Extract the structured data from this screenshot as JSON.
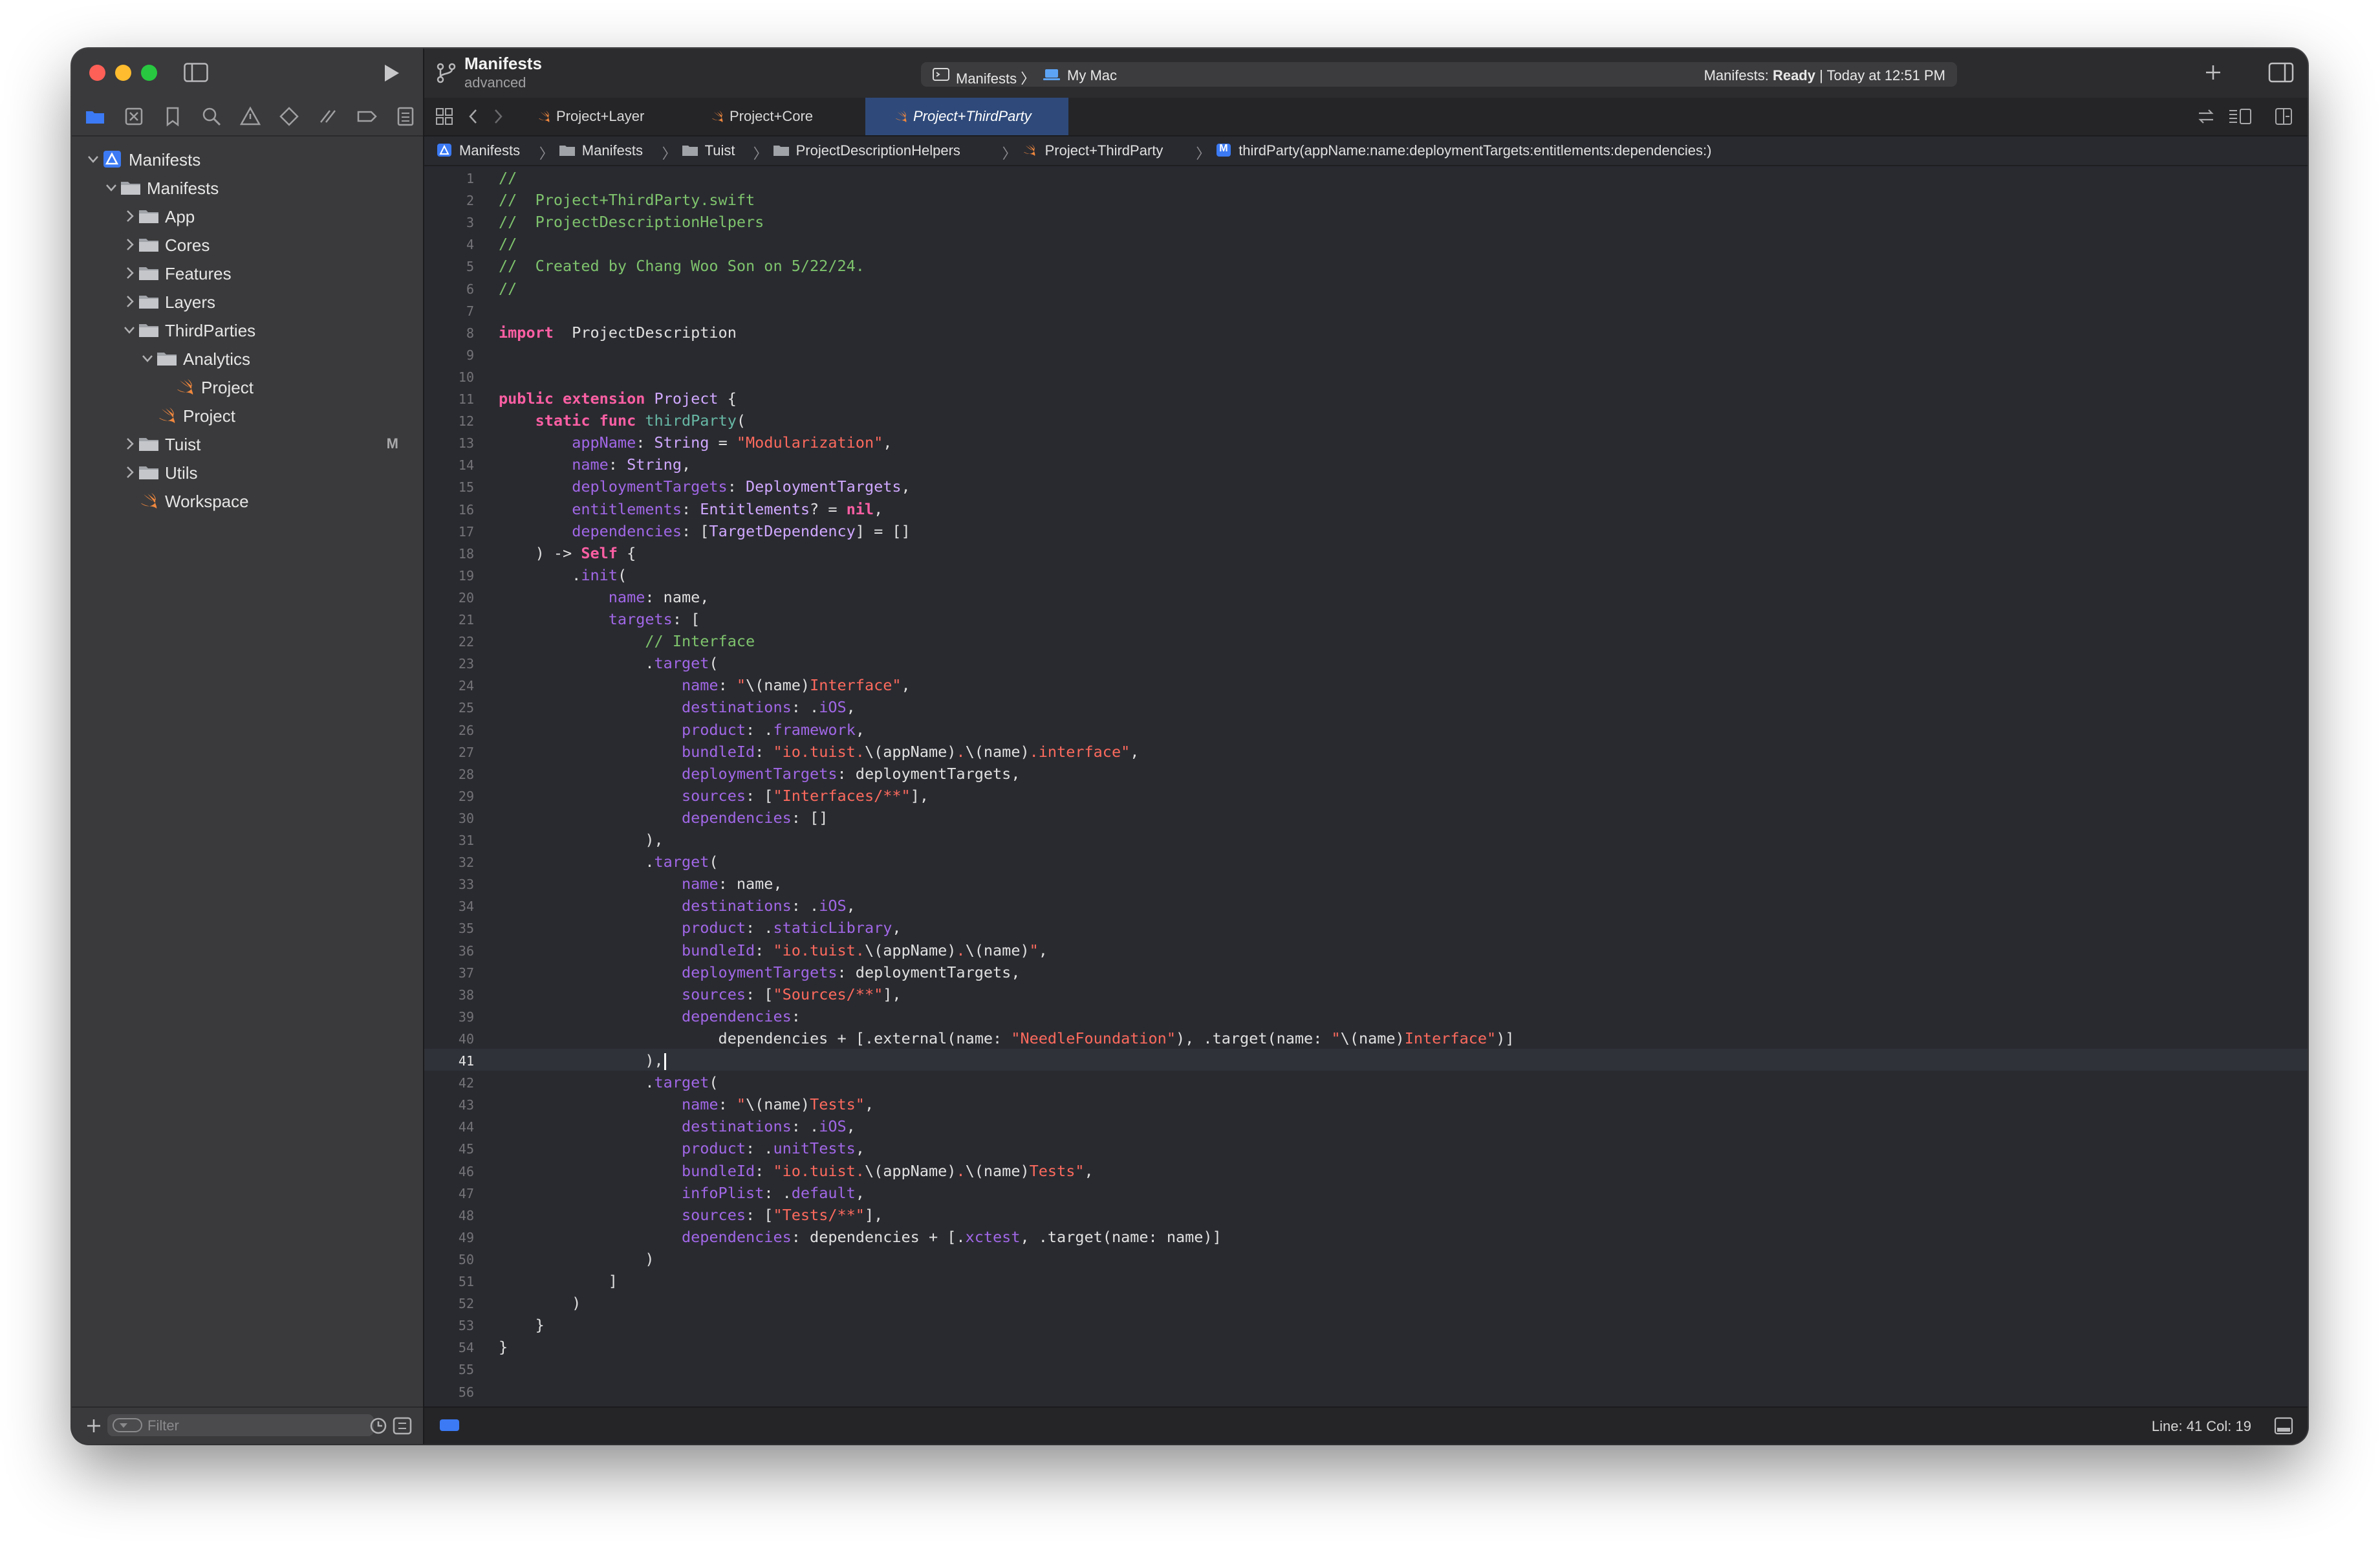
{
  "window": {
    "project_name": "Manifests",
    "project_subtitle": "advanced",
    "scheme": "Manifests",
    "destination": "My Mac",
    "status_prefix": "Manifests: ",
    "status_state": "Ready",
    "status_time": " | Today at 12:51 PM"
  },
  "navigator": {
    "items": [
      {
        "label": "Manifests",
        "icon": "xcode-project-icon",
        "indent": 0,
        "expanded": true
      },
      {
        "label": "Manifests",
        "icon": "folder-icon",
        "indent": 1,
        "expanded": true
      },
      {
        "label": "App",
        "icon": "folder-icon",
        "indent": 2,
        "expanded": false
      },
      {
        "label": "Cores",
        "icon": "folder-icon",
        "indent": 2,
        "expanded": false
      },
      {
        "label": "Features",
        "icon": "folder-icon",
        "indent": 2,
        "expanded": false
      },
      {
        "label": "Layers",
        "icon": "folder-icon",
        "indent": 2,
        "expanded": false
      },
      {
        "label": "ThirdParties",
        "icon": "folder-icon",
        "indent": 2,
        "expanded": true
      },
      {
        "label": "Analytics",
        "icon": "folder-icon",
        "indent": 3,
        "expanded": true
      },
      {
        "label": "Project",
        "icon": "swift-file-icon",
        "indent": 4,
        "expanded": null
      },
      {
        "label": "Project",
        "icon": "swift-file-icon",
        "indent": 3,
        "expanded": null
      },
      {
        "label": "Tuist",
        "icon": "folder-icon",
        "indent": 2,
        "expanded": false,
        "badge": "M"
      },
      {
        "label": "Utils",
        "icon": "folder-icon",
        "indent": 2,
        "expanded": false
      },
      {
        "label": "Workspace",
        "icon": "swift-file-icon",
        "indent": 2,
        "expanded": null
      }
    ],
    "filter_placeholder": "Filter"
  },
  "tabs": [
    {
      "label": "Project+Layer",
      "active": false
    },
    {
      "label": "Project+Core",
      "active": false
    },
    {
      "label": "Project+ThirdParty",
      "active": true
    }
  ],
  "breadcrumb": [
    {
      "label": "Manifests",
      "icon": "xcode-project-icon"
    },
    {
      "label": "Manifests",
      "icon": "folder-icon"
    },
    {
      "label": "Tuist",
      "icon": "folder-icon"
    },
    {
      "label": "ProjectDescriptionHelpers",
      "icon": "folder-icon"
    },
    {
      "label": "Project+ThirdParty",
      "icon": "swift-file-icon"
    },
    {
      "label": "thirdParty(appName:name:deploymentTargets:entitlements:dependencies:)",
      "icon": "method-icon",
      "icon_letter": "M"
    }
  ],
  "editor": {
    "current_line": 41,
    "lines": [
      [
        [
          "cm",
          "//"
        ]
      ],
      [
        [
          "cm",
          "//  Project+ThirdParty.swift"
        ]
      ],
      [
        [
          "cm",
          "//  ProjectDescriptionHelpers"
        ]
      ],
      [
        [
          "cm",
          "//"
        ]
      ],
      [
        [
          "cm",
          "//  Created by Chang Woo Son on 5/22/24."
        ]
      ],
      [
        [
          "cm",
          "//"
        ]
      ],
      [],
      [
        [
          "kw",
          "import"
        ],
        [
          "",
          "  ProjectDescription"
        ]
      ],
      [],
      [],
      [
        [
          "kw",
          "public"
        ],
        [
          "",
          " "
        ],
        [
          "kw",
          "extension"
        ],
        [
          "",
          " "
        ],
        [
          "ty",
          "Project"
        ],
        [
          "",
          " {"
        ]
      ],
      [
        [
          "",
          "    "
        ],
        [
          "kw",
          "static"
        ],
        [
          "",
          " "
        ],
        [
          "kw",
          "func"
        ],
        [
          "",
          " "
        ],
        [
          "fn",
          "thirdParty"
        ],
        [
          "",
          "("
        ]
      ],
      [
        [
          "",
          "        "
        ],
        [
          "pa",
          "appName"
        ],
        [
          "",
          ": "
        ],
        [
          "ty",
          "String"
        ],
        [
          "",
          " = "
        ],
        [
          "st",
          "\"Modularization\""
        ],
        [
          "",
          ","
        ]
      ],
      [
        [
          "",
          "        "
        ],
        [
          "pa",
          "name"
        ],
        [
          "",
          ": "
        ],
        [
          "ty",
          "String"
        ],
        [
          "",
          ","
        ]
      ],
      [
        [
          "",
          "        "
        ],
        [
          "pa",
          "deploymentTargets"
        ],
        [
          "",
          ": "
        ],
        [
          "ty",
          "DeploymentTargets"
        ],
        [
          "",
          ","
        ]
      ],
      [
        [
          "",
          "        "
        ],
        [
          "pa",
          "entitlements"
        ],
        [
          "",
          ": "
        ],
        [
          "ty",
          "Entitlements"
        ],
        [
          "",
          "? = "
        ],
        [
          "kw",
          "nil"
        ],
        [
          "",
          ","
        ]
      ],
      [
        [
          "",
          "        "
        ],
        [
          "pa",
          "dependencies"
        ],
        [
          "",
          ": ["
        ],
        [
          "ty",
          "TargetDependency"
        ],
        [
          "",
          "] = []"
        ]
      ],
      [
        [
          "",
          "    ) -> "
        ],
        [
          "kw",
          "Self"
        ],
        [
          "",
          " {"
        ]
      ],
      [
        [
          "",
          "        ."
        ],
        [
          "pa",
          "init"
        ],
        [
          "",
          "("
        ]
      ],
      [
        [
          "",
          "            "
        ],
        [
          "pa",
          "name"
        ],
        [
          "",
          ": name,"
        ]
      ],
      [
        [
          "",
          "            "
        ],
        [
          "pa",
          "targets"
        ],
        [
          "",
          ": ["
        ]
      ],
      [
        [
          "",
          "                "
        ],
        [
          "cm",
          "// Interface"
        ]
      ],
      [
        [
          "",
          "                ."
        ],
        [
          "pa",
          "target"
        ],
        [
          "",
          "("
        ]
      ],
      [
        [
          "",
          "                    "
        ],
        [
          "pa",
          "name"
        ],
        [
          "",
          ": "
        ],
        [
          "st",
          "\""
        ],
        [
          "",
          "\\(name)"
        ],
        [
          "st",
          "Interface\""
        ],
        [
          "",
          ","
        ]
      ],
      [
        [
          "",
          "                    "
        ],
        [
          "pa",
          "destinations"
        ],
        [
          "",
          ": ."
        ],
        [
          "pa",
          "iOS"
        ],
        [
          "",
          ","
        ]
      ],
      [
        [
          "",
          "                    "
        ],
        [
          "pa",
          "product"
        ],
        [
          "",
          ": ."
        ],
        [
          "pa",
          "framework"
        ],
        [
          "",
          ","
        ]
      ],
      [
        [
          "",
          "                    "
        ],
        [
          "pa",
          "bundleId"
        ],
        [
          "",
          ": "
        ],
        [
          "st",
          "\"io.tuist."
        ],
        [
          "",
          "\\(appName)"
        ],
        [
          "st",
          "."
        ],
        [
          "",
          "\\(name)"
        ],
        [
          "st",
          ".interface\""
        ],
        [
          "",
          ","
        ]
      ],
      [
        [
          "",
          "                    "
        ],
        [
          "pa",
          "deploymentTargets"
        ],
        [
          "",
          ": deploymentTargets,"
        ]
      ],
      [
        [
          "",
          "                    "
        ],
        [
          "pa",
          "sources"
        ],
        [
          "",
          ": ["
        ],
        [
          "st",
          "\"Interfaces/**\""
        ],
        [
          "",
          "],"
        ]
      ],
      [
        [
          "",
          "                    "
        ],
        [
          "pa",
          "dependencies"
        ],
        [
          "",
          ": []"
        ]
      ],
      [
        [
          "",
          "                ),"
        ]
      ],
      [
        [
          "",
          "                ."
        ],
        [
          "pa",
          "target"
        ],
        [
          "",
          "("
        ]
      ],
      [
        [
          "",
          "                    "
        ],
        [
          "pa",
          "name"
        ],
        [
          "",
          ": name,"
        ]
      ],
      [
        [
          "",
          "                    "
        ],
        [
          "pa",
          "destinations"
        ],
        [
          "",
          ": ."
        ],
        [
          "pa",
          "iOS"
        ],
        [
          "",
          ","
        ]
      ],
      [
        [
          "",
          "                    "
        ],
        [
          "pa",
          "product"
        ],
        [
          "",
          ": ."
        ],
        [
          "pa",
          "staticLibrary"
        ],
        [
          "",
          ","
        ]
      ],
      [
        [
          "",
          "                    "
        ],
        [
          "pa",
          "bundleId"
        ],
        [
          "",
          ": "
        ],
        [
          "st",
          "\"io.tuist."
        ],
        [
          "",
          "\\(appName)"
        ],
        [
          "st",
          "."
        ],
        [
          "",
          "\\(name)"
        ],
        [
          "st",
          "\""
        ],
        [
          "",
          ","
        ]
      ],
      [
        [
          "",
          "                    "
        ],
        [
          "pa",
          "deploymentTargets"
        ],
        [
          "",
          ": deploymentTargets,"
        ]
      ],
      [
        [
          "",
          "                    "
        ],
        [
          "pa",
          "sources"
        ],
        [
          "",
          ": ["
        ],
        [
          "st",
          "\"Sources/**\""
        ],
        [
          "",
          "],"
        ]
      ],
      [
        [
          "",
          "                    "
        ],
        [
          "pa",
          "dependencies"
        ],
        [
          "",
          ":"
        ]
      ],
      [
        [
          "",
          "                        dependencies + [.external(name: "
        ],
        [
          "st",
          "\"NeedleFoundation\""
        ],
        [
          "",
          "), .target(name: "
        ],
        [
          "st",
          "\""
        ],
        [
          "",
          "\\(name)"
        ],
        [
          "st",
          "Interface\""
        ],
        [
          "",
          ")]"
        ]
      ],
      [
        [
          "",
          "                ),"
        ]
      ],
      [
        [
          "",
          "                ."
        ],
        [
          "pa",
          "target"
        ],
        [
          "",
          "("
        ]
      ],
      [
        [
          "",
          "                    "
        ],
        [
          "pa",
          "name"
        ],
        [
          "",
          ": "
        ],
        [
          "st",
          "\""
        ],
        [
          "",
          "\\(name)"
        ],
        [
          "st",
          "Tests\""
        ],
        [
          "",
          ","
        ]
      ],
      [
        [
          "",
          "                    "
        ],
        [
          "pa",
          "destinations"
        ],
        [
          "",
          ": ."
        ],
        [
          "pa",
          "iOS"
        ],
        [
          "",
          ","
        ]
      ],
      [
        [
          "",
          "                    "
        ],
        [
          "pa",
          "product"
        ],
        [
          "",
          ": ."
        ],
        [
          "pa",
          "unitTests"
        ],
        [
          "",
          ","
        ]
      ],
      [
        [
          "",
          "                    "
        ],
        [
          "pa",
          "bundleId"
        ],
        [
          "",
          ": "
        ],
        [
          "st",
          "\"io.tuist."
        ],
        [
          "",
          "\\(appName)"
        ],
        [
          "st",
          "."
        ],
        [
          "",
          "\\(name)"
        ],
        [
          "st",
          "Tests\""
        ],
        [
          "",
          ","
        ]
      ],
      [
        [
          "",
          "                    "
        ],
        [
          "pa",
          "infoPlist"
        ],
        [
          "",
          ": ."
        ],
        [
          "pa",
          "default"
        ],
        [
          "",
          ","
        ]
      ],
      [
        [
          "",
          "                    "
        ],
        [
          "pa",
          "sources"
        ],
        [
          "",
          ": ["
        ],
        [
          "st",
          "\"Tests/**\""
        ],
        [
          "",
          "],"
        ]
      ],
      [
        [
          "",
          "                    "
        ],
        [
          "pa",
          "dependencies"
        ],
        [
          "",
          ": dependencies + [."
        ],
        [
          "pa",
          "xctest"
        ],
        [
          "",
          ", .target(name: name)]"
        ]
      ],
      [
        [
          "",
          "                )"
        ]
      ],
      [
        [
          "",
          "            ]"
        ]
      ],
      [
        [
          "",
          "        )"
        ]
      ],
      [
        [
          "",
          "    }"
        ]
      ],
      [
        [
          "",
          "}"
        ]
      ],
      [],
      []
    ]
  },
  "status_bar": {
    "position": "Line: 41  Col: 19"
  },
  "colors": {
    "accent": "#3b7af4",
    "keyword": "#fc5fa3",
    "comment": "#7ec36c",
    "string": "#fc6a5d",
    "type": "#d0a8ff",
    "property": "#a167e6",
    "swift_orange": "#f0883e"
  }
}
